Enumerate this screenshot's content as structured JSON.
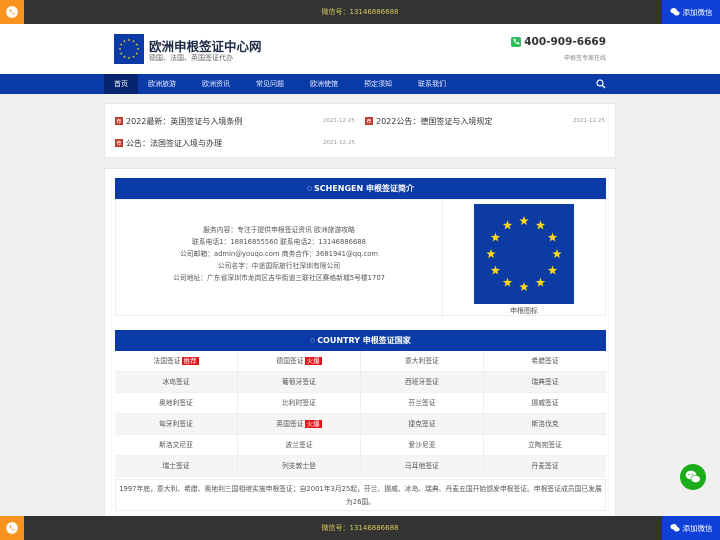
{
  "topbar": {
    "wechat_label": "微信号：13146886688",
    "add_wechat": "添加微信"
  },
  "bottombar": {
    "wechat_label": "微信号：13146886688",
    "add_wechat": "添加微信"
  },
  "header": {
    "title": "欧洲申根签证中心网",
    "subtitle": "德国、法国、英国签证代办",
    "hotline": "400-909-6669",
    "hotline_sub": "申根签专家在线"
  },
  "nav": {
    "items": [
      {
        "label": "首页",
        "active": true
      },
      {
        "label": "欧洲旅游"
      },
      {
        "label": "欧洲资讯"
      },
      {
        "label": "常见问题"
      },
      {
        "label": "欧洲使馆"
      },
      {
        "label": "预定须知"
      },
      {
        "label": "联系我们"
      }
    ]
  },
  "news": {
    "tag": "荐",
    "items": [
      {
        "title": "2022最新：英国签证与入境条例",
        "date": "2021-12-25"
      },
      {
        "title": "2022公告：德国签证与入境规定",
        "date": "2021-12-25"
      },
      {
        "title": "公告：法国签证入境与办理",
        "date": "2021-12-25"
      }
    ]
  },
  "intro": {
    "heading": "SCHENGEN 申根签证简介",
    "lines": [
      "服务内容：专注于提供申根签证资讯 欧洲旅游攻略",
      "联系电话1：18816855560 联系电话2：13146886688",
      "公司邮箱：admin@youqo.com 商务合作：3681941@qq.com",
      "公司名字：中途国际旅行社深圳有限公司",
      "公司地址：广东省深圳市龙岗区吉华街道三联社区赛格新城5号楼1707"
    ],
    "flag_caption": "申根图标"
  },
  "countries": {
    "heading": "COUNTRY 申根签证国家",
    "rows": [
      [
        {
          "name": "法国签证",
          "badge": "推荐"
        },
        {
          "name": "德国签证",
          "badge": "火爆"
        },
        {
          "name": "意大利签证"
        },
        {
          "name": "希腊签证"
        }
      ],
      [
        {
          "name": "冰岛签证"
        },
        {
          "name": "葡萄牙签证"
        },
        {
          "name": "西班牙签证"
        },
        {
          "name": "瑞典签证"
        }
      ],
      [
        {
          "name": "奥地利签证"
        },
        {
          "name": "比利时签证"
        },
        {
          "name": "芬兰签证"
        },
        {
          "name": "挪威签证"
        }
      ],
      [
        {
          "name": "匈牙利签证"
        },
        {
          "name": "英国签证",
          "badge": "火爆"
        },
        {
          "name": "捷克签证"
        },
        {
          "name": "斯洛伐克"
        }
      ],
      [
        {
          "name": "斯洛文尼亚"
        },
        {
          "name": "波兰签证"
        },
        {
          "name": "爱沙尼亚"
        },
        {
          "name": "立陶宛签证"
        }
      ],
      [
        {
          "name": "瑞士签证"
        },
        {
          "name": "列支敦士登"
        },
        {
          "name": "马耳他签证"
        },
        {
          "name": "丹麦签证"
        }
      ]
    ],
    "summary": "1997年底，意大利、希腊、奥地利三国相继实施申根签证；自2001年3月25起，芬兰、挪威、冰岛、瑞典、丹麦五国开始颁发申根签证。申根签证成员国已发展为26国。"
  },
  "colors": {
    "brand_blue": "#0a3aa8",
    "accent_orange": "#f7931e",
    "badge_red": "#e0161b",
    "wechat_green": "#1aad19"
  }
}
